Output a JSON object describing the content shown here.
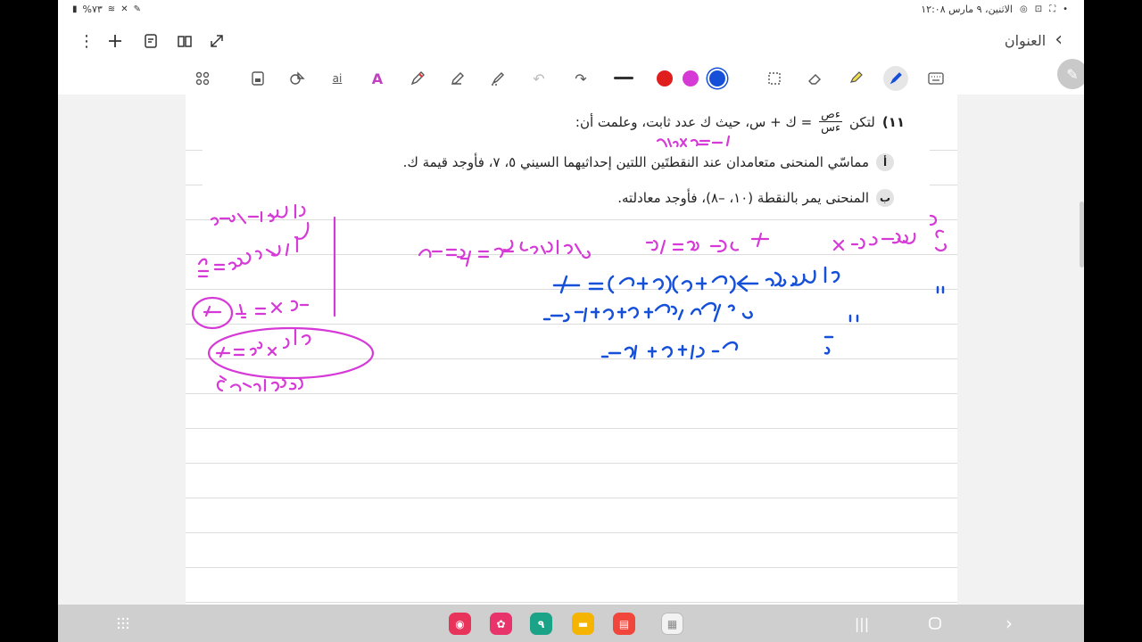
{
  "status_bar": {
    "battery": "%٧٣",
    "datetime": "الاثنين، ٩ مارس ١٢:٠٨"
  },
  "app_bar": {
    "title": "العنوان",
    "icons": [
      "more-vertical-icon",
      "add-icon",
      "page-settings-icon",
      "reading-mode-icon",
      "expand-icon",
      "back-chevron-icon"
    ]
  },
  "pen_toolbar": {
    "colors": {
      "red": "#e01e1e",
      "magenta": "#d63ad6",
      "blue": "#1650d8"
    },
    "selected_color": "blue"
  },
  "question": {
    "number": "١١)",
    "intro_prefix": "لتكن",
    "fraction_num": "ءص",
    "fraction_den": "ءس",
    "intro_rest": "= ك + س، حيث ك عدد ثابت، وعلمت أن:",
    "part_a_label": "أ",
    "part_a_text": "مماسّي المنحنى متعامدان عند النقطتَين اللتين إحداثيهما السيني ٥، ٧، فأوجد قيمة ك.",
    "part_b_label": "ب",
    "part_b_text": "المنحنى يمر بالنقطة (١٠، –٨)، فأوجد معادلته."
  },
  "handwriting": {
    "pink_note_top": "٣×٣=–١",
    "pink_side_1": "ميل لمماس=٢م=٥",
    "pink_side_2": "ميل لعمو=م٢=١/٥",
    "pink_side_3": "١/٥×٥=–١",
    "pink_side_4": "م١×م٢=–١",
    "pink_side_5": "متعامدان",
    "pink_eq_1": "ميل لمماس(١) ءص/ءس = ك+٥ ، ميل لمماس(٢) ءص/ءس = ك+٧",
    "blue_eq_1": "∴ متعامدان ⇐ (ك+٥)(ك+٧) = –١",
    "blue_eq_2": "∴ ك٢+٧ك+٥ك+٣٥+١=٠",
    "blue_eq_3": "ك٢+١٢ك+٣٦=٠"
  },
  "nav_bar": {
    "dock_apps": [
      "camera-app-icon",
      "flower-app-icon",
      "calendar-app-icon",
      "files-app-icon",
      "notes-app-icon",
      "multi-app-icon"
    ],
    "calendar_day": "٩"
  }
}
